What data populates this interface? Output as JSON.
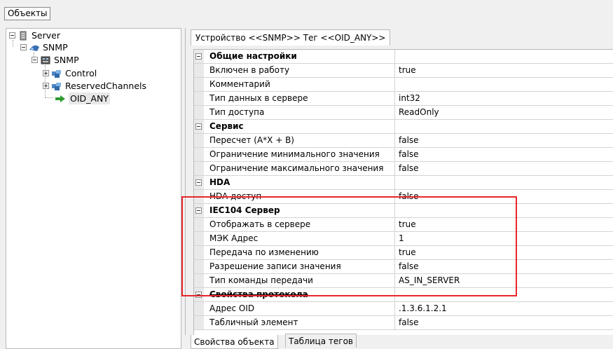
{
  "toolbar": {
    "objects_label": "Объекты"
  },
  "tree": {
    "server": "Server",
    "snmp_group": "SNMP",
    "snmp_device": "SNMP",
    "control": "Control",
    "reserved": "ReservedChannels",
    "oid_any": "OID_ANY"
  },
  "tab": {
    "title": "Устройство <<SNMP>> Тег  <<OID_ANY>>"
  },
  "grid": {
    "rows": [
      {
        "name": "Общие настройки",
        "value": ""
      },
      {
        "name": "Включен в работу",
        "value": "true"
      },
      {
        "name": "Комментарий",
        "value": ""
      },
      {
        "name": "Тип данных в сервере",
        "value": "int32"
      },
      {
        "name": "Тип доступа",
        "value": "ReadOnly"
      },
      {
        "name": "Сервис",
        "value": ""
      },
      {
        "name": "Пересчет (A*X + B)",
        "value": "false"
      },
      {
        "name": "Ограничение минимального значения",
        "value": "false"
      },
      {
        "name": "Ограничение максимального значения",
        "value": "false"
      },
      {
        "name": "HDA",
        "value": ""
      },
      {
        "name": "HDA доступ",
        "value": "false"
      },
      {
        "name": "IEC104 Сервер",
        "value": ""
      },
      {
        "name": "Отображать в сервере",
        "value": "true"
      },
      {
        "name": "МЭК Адрес",
        "value": "1"
      },
      {
        "name": "Передача по изменению",
        "value": "true"
      },
      {
        "name": "Разрешение записи значения",
        "value": "false"
      },
      {
        "name": "Тип команды передачи",
        "value": "AS_IN_SERVER"
      },
      {
        "name": "Свойства протокола",
        "value": ""
      },
      {
        "name": "Адрес OID",
        "value": ".1.3.6.1.2.1"
      },
      {
        "name": "Табличный элемент",
        "value": "false"
      }
    ]
  },
  "bottom_tabs": {
    "object_props": "Свойства объекта",
    "tags_table": "Таблица тегов"
  },
  "colors": {
    "highlight_box": "#e8262a"
  }
}
